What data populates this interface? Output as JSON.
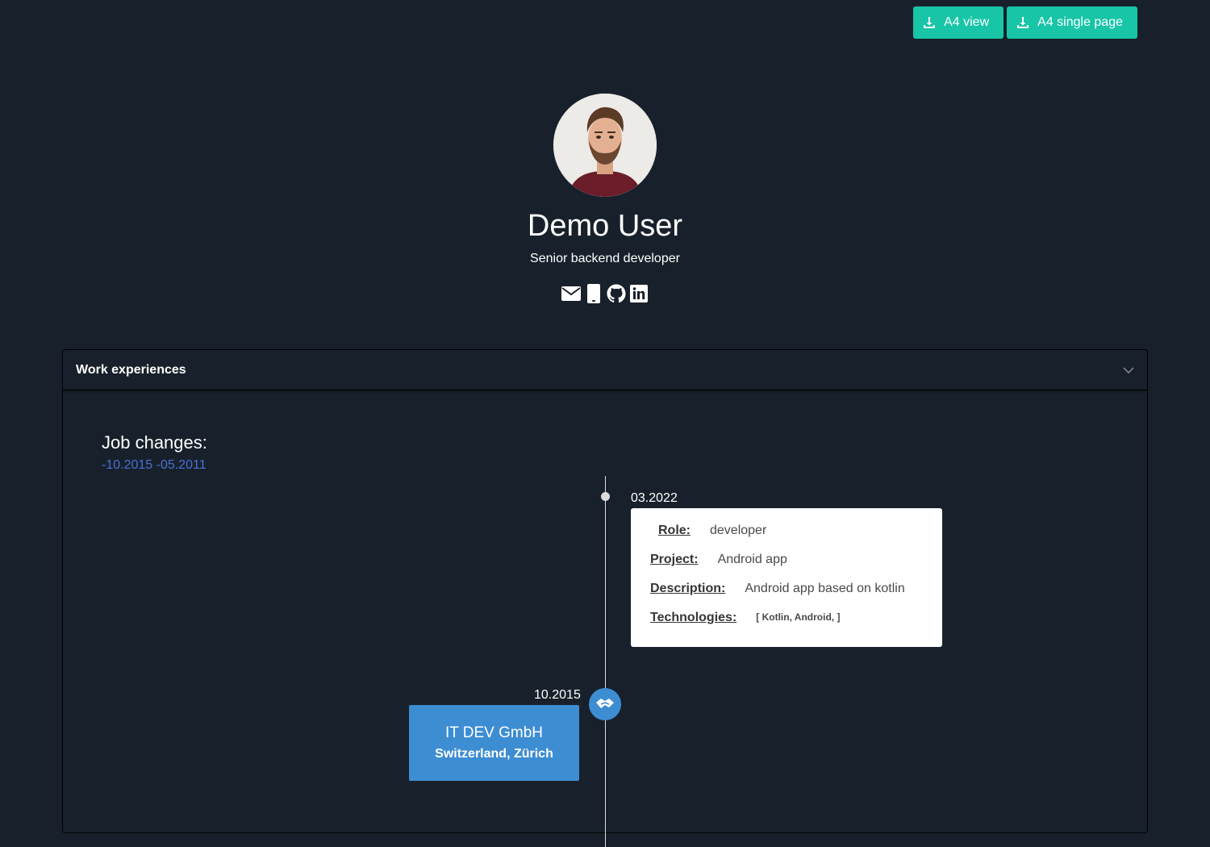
{
  "toolbar": {
    "a4_view_label": "A4 view",
    "a4_single_page_label": "A4 single page"
  },
  "profile": {
    "name": "Demo User",
    "role": "Senior backend developer",
    "contacts": [
      {
        "icon": "envelope-icon"
      },
      {
        "icon": "mobile-phone-icon"
      },
      {
        "icon": "github-icon"
      },
      {
        "icon": "linkedin-icon"
      }
    ]
  },
  "work": {
    "section_title": "Work experiences",
    "job_changes_title": "Job changes:",
    "job_changes_dates": "-10.2015 -05.2011",
    "timeline": {
      "project": {
        "date": "03.2022",
        "role_label": "Role:",
        "role": "developer",
        "project_label": "Project:",
        "project": "Android app",
        "description_label": "Description:",
        "description": "Android app based on kotlin",
        "technologies_label": "Technologies:",
        "technologies": "[ Kotlin, Android, ]"
      },
      "job_change": {
        "date": "10.2015",
        "company": "IT DEV GmbH",
        "location": "Switzerland, Zürich"
      }
    }
  },
  "colors": {
    "background": "#18212b",
    "accent_button": "#18c5a7",
    "timeline_blue": "#3d8dd3",
    "date_link": "#4a6fd6"
  }
}
